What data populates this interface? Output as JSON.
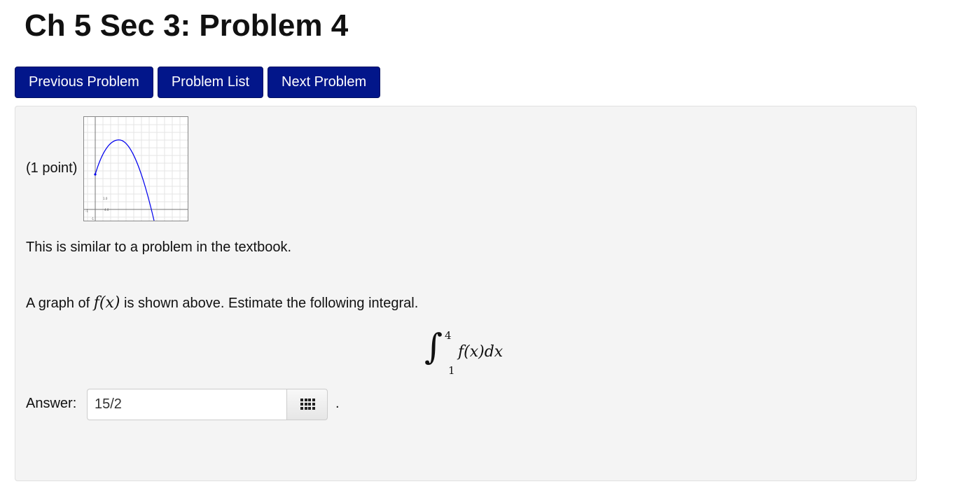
{
  "page": {
    "title": "Ch 5 Sec 3: Problem 4"
  },
  "nav": {
    "previous_label": "Previous Problem",
    "list_label": "Problem List",
    "next_label": "Next Problem"
  },
  "problem": {
    "points": "(1 point)",
    "intro": "This is similar to a problem in the textbook.",
    "question_prefix": "A graph of ",
    "question_math": "f(x)",
    "question_suffix": " is shown above. Estimate the following integral.",
    "integral": {
      "lower": "1",
      "upper": "4",
      "integrand": "f(x)dx"
    },
    "answer_label": "Answer:",
    "answer_value": "15/2",
    "trailing": "."
  },
  "graph": {
    "axis_tick_labels": [
      "1.0",
      "4.0",
      "-1",
      "-1"
    ],
    "curve_color": "#0000ff"
  },
  "colors": {
    "nav_button_bg": "#02168a",
    "panel_bg": "#f4f4f4"
  }
}
